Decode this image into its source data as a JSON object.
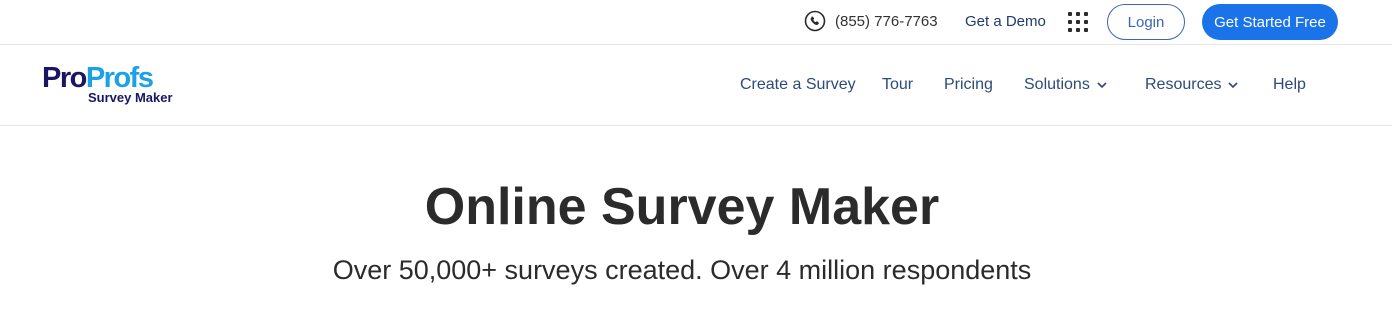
{
  "topbar": {
    "phone": "(855) 776-7763",
    "demo": "Get a Demo",
    "login": "Login",
    "get_started": "Get Started Free"
  },
  "logo": {
    "pro": "Pro",
    "profs": "Profs",
    "product": "Survey Maker"
  },
  "nav": {
    "items": [
      {
        "label": "Create a Survey"
      },
      {
        "label": "Tour"
      },
      {
        "label": "Pricing"
      },
      {
        "label": "Solutions"
      },
      {
        "label": "Resources"
      },
      {
        "label": "Help"
      }
    ]
  },
  "hero": {
    "title": "Online Survey Maker",
    "subtitle": "Over 50,000+ surveys created. Over 4 million respondents"
  },
  "colors": {
    "primary": "#1a73e8",
    "logo_dark": "#1b1664",
    "logo_light": "#1ca0e6",
    "nav_text": "#2d4a7a"
  }
}
